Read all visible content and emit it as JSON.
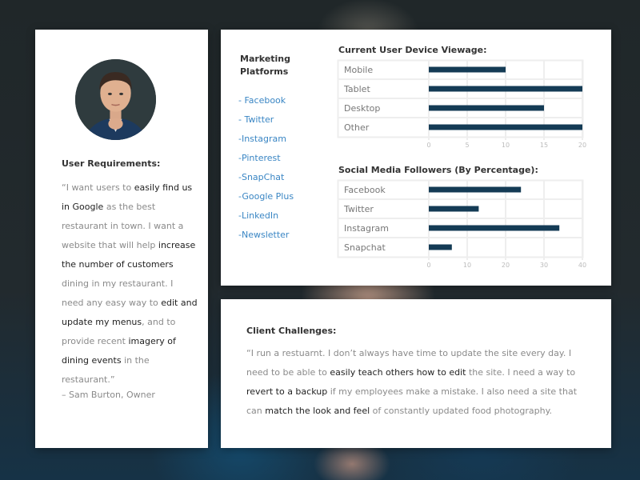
{
  "user_requirements": {
    "title": "User Requirements:",
    "quote_segments": [
      {
        "text": "“I want users to ",
        "emphasis": false
      },
      {
        "text": "easily find us in Google",
        "emphasis": true
      },
      {
        "text": " as the best restaurant in town. I want a website that will help ",
        "emphasis": false
      },
      {
        "text": "increase the number of customers",
        "emphasis": true
      },
      {
        "text": " dining in my restaurant. I need any easy way to ",
        "emphasis": false
      },
      {
        "text": "edit and update my menus",
        "emphasis": true
      },
      {
        "text": ", and to provide recent ",
        "emphasis": false
      },
      {
        "text": "imagery of dining events",
        "emphasis": true
      },
      {
        "text": " in the restaurant.”",
        "emphasis": false
      }
    ],
    "signature": "– Sam Burton, Owner"
  },
  "marketing": {
    "title_line1": "Marketing",
    "title_line2": "Platforms",
    "items": [
      "- Facebook",
      "- Twitter",
      "-Instagram",
      "-Pinterest",
      "-SnapChat",
      "-Google Plus",
      "-LinkedIn",
      "-Newsletter"
    ]
  },
  "colors": {
    "bar": "#143b55",
    "link": "#3a86c4",
    "grid": "#eeeeee"
  },
  "chart_data": [
    {
      "type": "bar",
      "orientation": "horizontal",
      "title": "Current User Device Viewage:",
      "categories": [
        "Mobile",
        "Tablet",
        "Desktop",
        "Other"
      ],
      "values": [
        10,
        21,
        15,
        21
      ],
      "xlim": [
        0,
        20
      ],
      "xticks": [
        0,
        5,
        10,
        15,
        20
      ],
      "xlabel": "",
      "ylabel": "",
      "grid": true
    },
    {
      "type": "bar",
      "orientation": "horizontal",
      "title": "Social Media Followers (By Percentage):",
      "categories": [
        "Facebook",
        "Twitter",
        "Instagram",
        "Snapchat"
      ],
      "values": [
        24,
        13,
        34,
        6
      ],
      "xlim": [
        0,
        40
      ],
      "xticks": [
        0,
        10,
        20,
        30,
        40
      ],
      "xlabel": "",
      "ylabel": "",
      "grid": true
    }
  ],
  "client_challenges": {
    "title": "Client Challenges:",
    "quote_segments": [
      {
        "text": "“I run a restuarnt. I don’t always have time to update the site every day. I need to be able to ",
        "emphasis": false
      },
      {
        "text": "easily teach others how to edit",
        "emphasis": true
      },
      {
        "text": " the site. I need a way to ",
        "emphasis": false
      },
      {
        "text": "revert to a backup",
        "emphasis": true
      },
      {
        "text": " if my employees make a mistake. I also need a site that can ",
        "emphasis": false
      },
      {
        "text": "match the look and feel",
        "emphasis": true
      },
      {
        "text": " of constantly updated food photography.",
        "emphasis": false
      }
    ]
  }
}
